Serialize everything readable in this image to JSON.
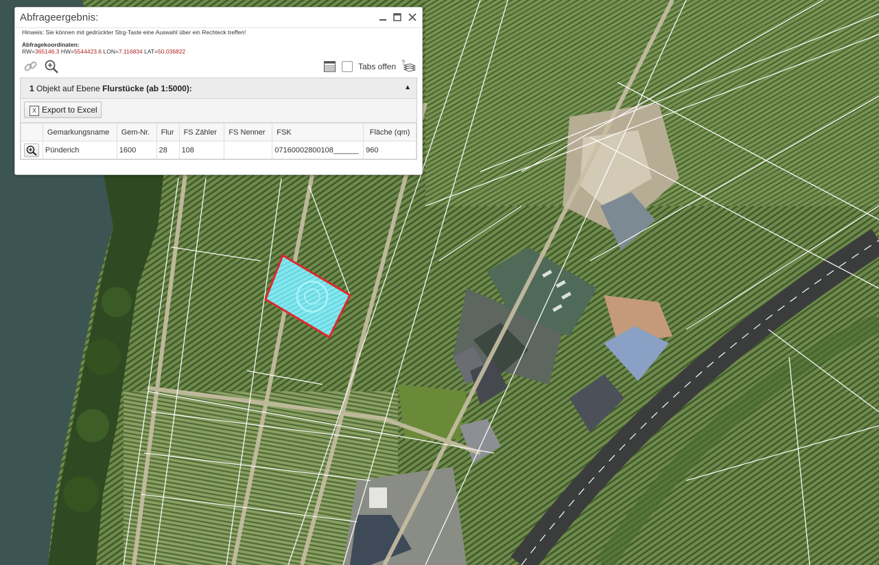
{
  "dialog": {
    "title": "Abfrageergebnis:",
    "hint": "Hinweis: Sie können mit gedrückter Strg-Taste eine Auswahl über ein Rechteck treffen!",
    "coords_label": "Abfragekoordinaten:",
    "coords": {
      "rw_label": "RW=",
      "rw": "365146.3",
      "hw_label": " HW=",
      "hw": "5544423.6",
      "lon_label": " LON=",
      "lon": "7.116834",
      "lat_label": " LAT=",
      "lat": "50.036822"
    },
    "tabs_label": "Tabs offen",
    "icons": {
      "minimize": "minimize-icon",
      "maximize": "maximize-icon",
      "close": "close-icon",
      "link": "link-icon",
      "zoom": "zoom-in-icon",
      "table": "table-icon",
      "layers": "layers-help-icon"
    }
  },
  "panel": {
    "count": "1",
    "text_mid": " Objekt auf Ebene ",
    "layer": "Flurstücke (ab 1:5000):",
    "toggle": "▲",
    "export_label": "Export to Excel",
    "excel_icon": "X"
  },
  "table": {
    "columns": [
      "Gemarkungsname",
      "Gem-Nr.",
      "Flur",
      "FS Zähler",
      "FS Nenner",
      "FSK",
      "Fläche (qm)"
    ],
    "rows": [
      [
        "Pünderich",
        "1600",
        "28",
        "108",
        "",
        "07160002800108______",
        "960"
      ]
    ]
  },
  "colors": {
    "coord_value": "#b02020",
    "highlight_border": "#e0282a",
    "highlight_fill": "#7fe8ee"
  }
}
